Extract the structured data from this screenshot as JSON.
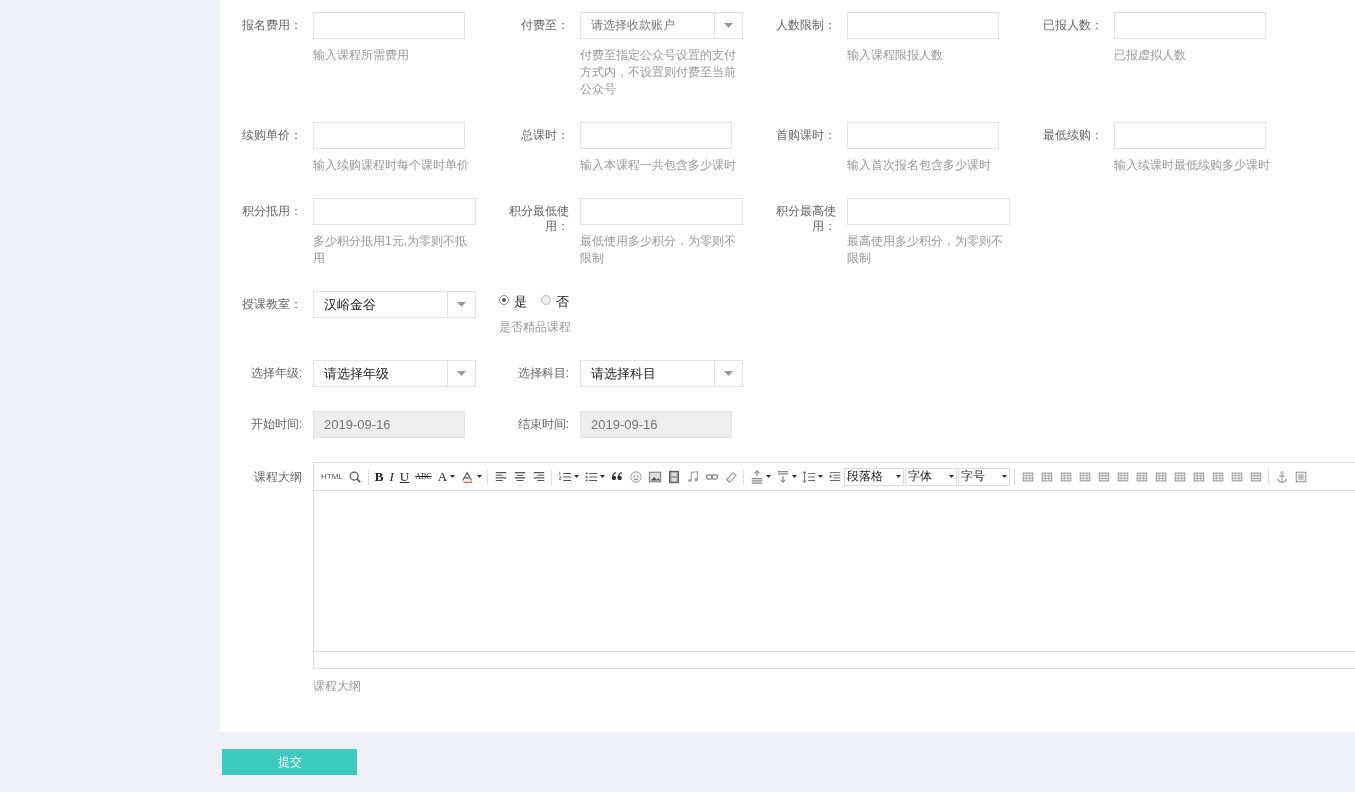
{
  "rows": [
    {
      "fields": [
        {
          "kind": "text",
          "label": "报名费用：",
          "help": "输入课程所需费用"
        },
        {
          "kind": "select",
          "label": "付费至：",
          "placeholder": "请选择收款账户",
          "help": "付费至指定公众号设置的支付方式内，不设置则付费至当前公众号"
        },
        {
          "kind": "text",
          "label": "人数限制：",
          "help": "输入课程限报人数"
        },
        {
          "kind": "text",
          "label": "已报人数：",
          "help": "已报虚拟人数"
        }
      ]
    },
    {
      "fields": [
        {
          "kind": "text",
          "label": "续购单价：",
          "help": "输入续购课程时每个课时单价"
        },
        {
          "kind": "text",
          "label": "总课时：",
          "help": "输入本课程一共包含多少课时"
        },
        {
          "kind": "text",
          "label": "首购课时：",
          "help": "输入首次报名包含多少课时"
        },
        {
          "kind": "text",
          "label": "最低续购：",
          "help": "输入续课时最低续购多少课时"
        }
      ]
    },
    {
      "fields": [
        {
          "kind": "text",
          "label": "积分抵用：",
          "help": "多少积分抵用1元,为零则不抵用"
        },
        {
          "kind": "text",
          "label": "积分最低使用：",
          "help": "最低使用多少积分，为零则不限制"
        },
        {
          "kind": "text",
          "label": "积分最高使用：",
          "help": "最高使用多少积分，为零则不限制"
        }
      ]
    },
    {
      "fields": [
        {
          "kind": "select",
          "label": "授课教室：",
          "value": "汉峪金谷"
        },
        {
          "kind": "radio",
          "options": [
            {
              "label": "是",
              "selected": true
            },
            {
              "label": "否",
              "selected": false
            }
          ],
          "help": "是否精品课程"
        }
      ]
    },
    {
      "fields": [
        {
          "kind": "select",
          "label": "选择年级:",
          "value": "请选择年级"
        },
        {
          "kind": "select",
          "label": "选择科目:",
          "value": "请选择科目"
        }
      ]
    },
    {
      "fields": [
        {
          "kind": "date",
          "label": "开始时间:",
          "value": "2019-09-16"
        },
        {
          "kind": "date",
          "label": "结束时间:",
          "value": "2019-09-16"
        }
      ]
    }
  ],
  "editor": {
    "label": "课程大纲",
    "help": "课程大纲",
    "toolbar": {
      "html": "HTML",
      "bold": "B",
      "italic": "I",
      "underline": "U",
      "strike": "ABC",
      "font_color": "A",
      "paragraph": "段落格",
      "font": "字体",
      "size": "字号"
    }
  },
  "submit": "提交"
}
